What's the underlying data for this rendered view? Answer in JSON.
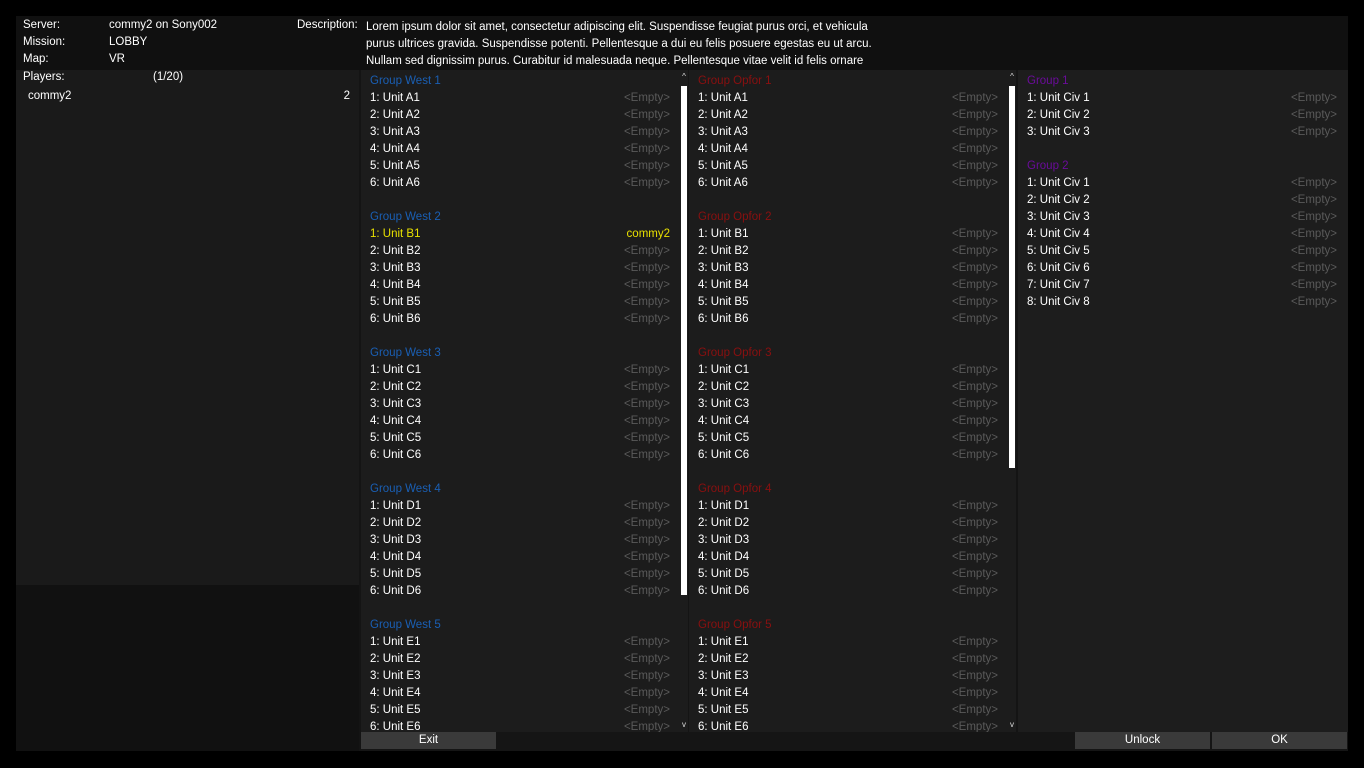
{
  "header": {
    "server_label": "Server:",
    "server_value": "commy2 on Sony002",
    "mission_label": "Mission:",
    "mission_value": "LOBBY",
    "map_label": "Map:",
    "map_value": "VR",
    "description_label": "Description:",
    "description_lines": [
      "Lorem ipsum dolor sit amet, consectetur adipiscing elit. Suspendisse feugiat purus orci, et vehicula",
      "purus ultrices gravida. Suspendisse potenti. Pellentesque a dui eu felis posuere egestas eu ut arcu.",
      "Nullam sed dignissim purus. Curabitur id malesuada neque. Pellentesque vitae velit id felis ornare"
    ]
  },
  "players": {
    "label": "Players:",
    "count": "(1/20)",
    "list": [
      {
        "name": "commy2",
        "value": "2"
      }
    ]
  },
  "colors": {
    "west": "#1a5fb4",
    "opfor": "#8a1010",
    "civ": "#6a0c9a",
    "mine": "#e8e000",
    "empty": "#5a5a5a"
  },
  "west": {
    "groups": [
      {
        "title": "Group West 1",
        "slots": [
          {
            "role": "1: Unit A1",
            "occ": "<Empty>"
          },
          {
            "role": "2: Unit A2",
            "occ": "<Empty>"
          },
          {
            "role": "3: Unit A3",
            "occ": "<Empty>"
          },
          {
            "role": "4: Unit A4",
            "occ": "<Empty>"
          },
          {
            "role": "5: Unit A5",
            "occ": "<Empty>"
          },
          {
            "role": "6: Unit A6",
            "occ": "<Empty>"
          }
        ]
      },
      {
        "title": "Group West 2",
        "slots": [
          {
            "role": "1: Unit B1",
            "occ": "commy2",
            "mine": true
          },
          {
            "role": "2: Unit B2",
            "occ": "<Empty>"
          },
          {
            "role": "3: Unit B3",
            "occ": "<Empty>"
          },
          {
            "role": "4: Unit B4",
            "occ": "<Empty>"
          },
          {
            "role": "5: Unit B5",
            "occ": "<Empty>"
          },
          {
            "role": "6: Unit B6",
            "occ": "<Empty>"
          }
        ]
      },
      {
        "title": "Group West 3",
        "slots": [
          {
            "role": "1: Unit C1",
            "occ": "<Empty>"
          },
          {
            "role": "2: Unit C2",
            "occ": "<Empty>"
          },
          {
            "role": "3: Unit C3",
            "occ": "<Empty>"
          },
          {
            "role": "4: Unit C4",
            "occ": "<Empty>"
          },
          {
            "role": "5: Unit C5",
            "occ": "<Empty>"
          },
          {
            "role": "6: Unit C6",
            "occ": "<Empty>"
          }
        ]
      },
      {
        "title": "Group West 4",
        "slots": [
          {
            "role": "1: Unit D1",
            "occ": "<Empty>"
          },
          {
            "role": "2: Unit D2",
            "occ": "<Empty>"
          },
          {
            "role": "3: Unit D3",
            "occ": "<Empty>"
          },
          {
            "role": "4: Unit D4",
            "occ": "<Empty>"
          },
          {
            "role": "5: Unit D5",
            "occ": "<Empty>"
          },
          {
            "role": "6: Unit D6",
            "occ": "<Empty>"
          }
        ]
      },
      {
        "title": "Group West 5",
        "slots": [
          {
            "role": "1: Unit E1",
            "occ": "<Empty>"
          },
          {
            "role": "2: Unit E2",
            "occ": "<Empty>"
          },
          {
            "role": "3: Unit E3",
            "occ": "<Empty>"
          },
          {
            "role": "4: Unit E4",
            "occ": "<Empty>"
          },
          {
            "role": "5: Unit E5",
            "occ": "<Empty>"
          },
          {
            "role": "6: Unit E6",
            "occ": "<Empty>"
          }
        ]
      }
    ]
  },
  "opfor": {
    "groups": [
      {
        "title": "Group Opfor 1",
        "slots": [
          {
            "role": "1: Unit A1",
            "occ": "<Empty>"
          },
          {
            "role": "2: Unit A2",
            "occ": "<Empty>"
          },
          {
            "role": "3: Unit A3",
            "occ": "<Empty>"
          },
          {
            "role": "4: Unit A4",
            "occ": "<Empty>"
          },
          {
            "role": "5: Unit A5",
            "occ": "<Empty>"
          },
          {
            "role": "6: Unit A6",
            "occ": "<Empty>"
          }
        ]
      },
      {
        "title": "Group Opfor 2",
        "slots": [
          {
            "role": "1: Unit B1",
            "occ": "<Empty>"
          },
          {
            "role": "2: Unit B2",
            "occ": "<Empty>"
          },
          {
            "role": "3: Unit B3",
            "occ": "<Empty>"
          },
          {
            "role": "4: Unit B4",
            "occ": "<Empty>"
          },
          {
            "role": "5: Unit B5",
            "occ": "<Empty>"
          },
          {
            "role": "6: Unit B6",
            "occ": "<Empty>"
          }
        ]
      },
      {
        "title": "Group Opfor 3",
        "slots": [
          {
            "role": "1: Unit C1",
            "occ": "<Empty>"
          },
          {
            "role": "2: Unit C2",
            "occ": "<Empty>"
          },
          {
            "role": "3: Unit C3",
            "occ": "<Empty>"
          },
          {
            "role": "4: Unit C4",
            "occ": "<Empty>"
          },
          {
            "role": "5: Unit C5",
            "occ": "<Empty>"
          },
          {
            "role": "6: Unit C6",
            "occ": "<Empty>"
          }
        ]
      },
      {
        "title": "Group Opfor 4",
        "slots": [
          {
            "role": "1: Unit D1",
            "occ": "<Empty>"
          },
          {
            "role": "2: Unit D2",
            "occ": "<Empty>"
          },
          {
            "role": "3: Unit D3",
            "occ": "<Empty>"
          },
          {
            "role": "4: Unit D4",
            "occ": "<Empty>"
          },
          {
            "role": "5: Unit D5",
            "occ": "<Empty>"
          },
          {
            "role": "6: Unit D6",
            "occ": "<Empty>"
          }
        ]
      },
      {
        "title": "Group Opfor 5",
        "slots": [
          {
            "role": "1: Unit E1",
            "occ": "<Empty>"
          },
          {
            "role": "2: Unit E2",
            "occ": "<Empty>"
          },
          {
            "role": "3: Unit E3",
            "occ": "<Empty>"
          },
          {
            "role": "4: Unit E4",
            "occ": "<Empty>"
          },
          {
            "role": "5: Unit E5",
            "occ": "<Empty>"
          },
          {
            "role": "6: Unit E6",
            "occ": "<Empty>"
          }
        ]
      }
    ]
  },
  "civ": {
    "groups": [
      {
        "title": "Group 1",
        "slots": [
          {
            "role": "1: Unit Civ 1",
            "occ": "<Empty>"
          },
          {
            "role": "2: Unit Civ 2",
            "occ": "<Empty>"
          },
          {
            "role": "3: Unit Civ 3",
            "occ": "<Empty>"
          }
        ]
      },
      {
        "title": "Group 2",
        "slots": [
          {
            "role": "1: Unit Civ 1",
            "occ": "<Empty>"
          },
          {
            "role": "2: Unit Civ 2",
            "occ": "<Empty>"
          },
          {
            "role": "3: Unit Civ 3",
            "occ": "<Empty>"
          },
          {
            "role": "4: Unit Civ 4",
            "occ": "<Empty>"
          },
          {
            "role": "5: Unit Civ 5",
            "occ": "<Empty>"
          },
          {
            "role": "6: Unit Civ 6",
            "occ": "<Empty>"
          },
          {
            "role": "7: Unit Civ 7",
            "occ": "<Empty>"
          },
          {
            "role": "8: Unit Civ 8",
            "occ": "<Empty>"
          }
        ]
      }
    ]
  },
  "scroll_arrows": {
    "up": "^",
    "down": "v"
  },
  "buttons": {
    "exit": "Exit",
    "unlock": "Unlock",
    "ok": "OK"
  }
}
